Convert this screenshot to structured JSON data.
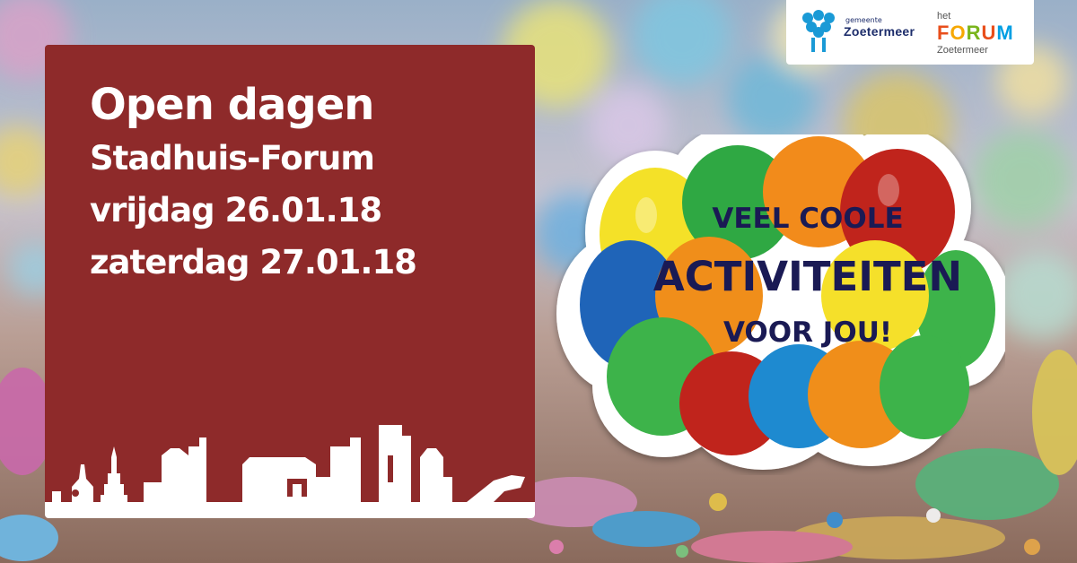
{
  "panel": {
    "title": "Open dagen",
    "line1": "Stadhuis-Forum",
    "line2": "vrijdag 26.01.18",
    "line3": "zaterdag 27.01.18"
  },
  "logos": {
    "gemeente_small": "gemeente",
    "gemeente_name": "Zoetermeer",
    "forum_het": "het",
    "forum_letters": [
      "F",
      "O",
      "R",
      "U",
      "M"
    ],
    "forum_city": "Zoetermeer"
  },
  "sticker": {
    "line1": "VEEL COOLE",
    "line2": "ACTIVITEITEN",
    "line3": "VOOR JOU!"
  },
  "colors": {
    "panel": "#8e2a2a",
    "gemeente_blue": "#1d2d6b",
    "forum_letters": [
      "#e84e1b",
      "#f6a800",
      "#7ab51d",
      "#e84e1b",
      "#009fe3"
    ]
  },
  "icons": [
    "gemeente-logo-icon",
    "forum-logo-icon",
    "skyline-icon",
    "balloons-icon"
  ]
}
